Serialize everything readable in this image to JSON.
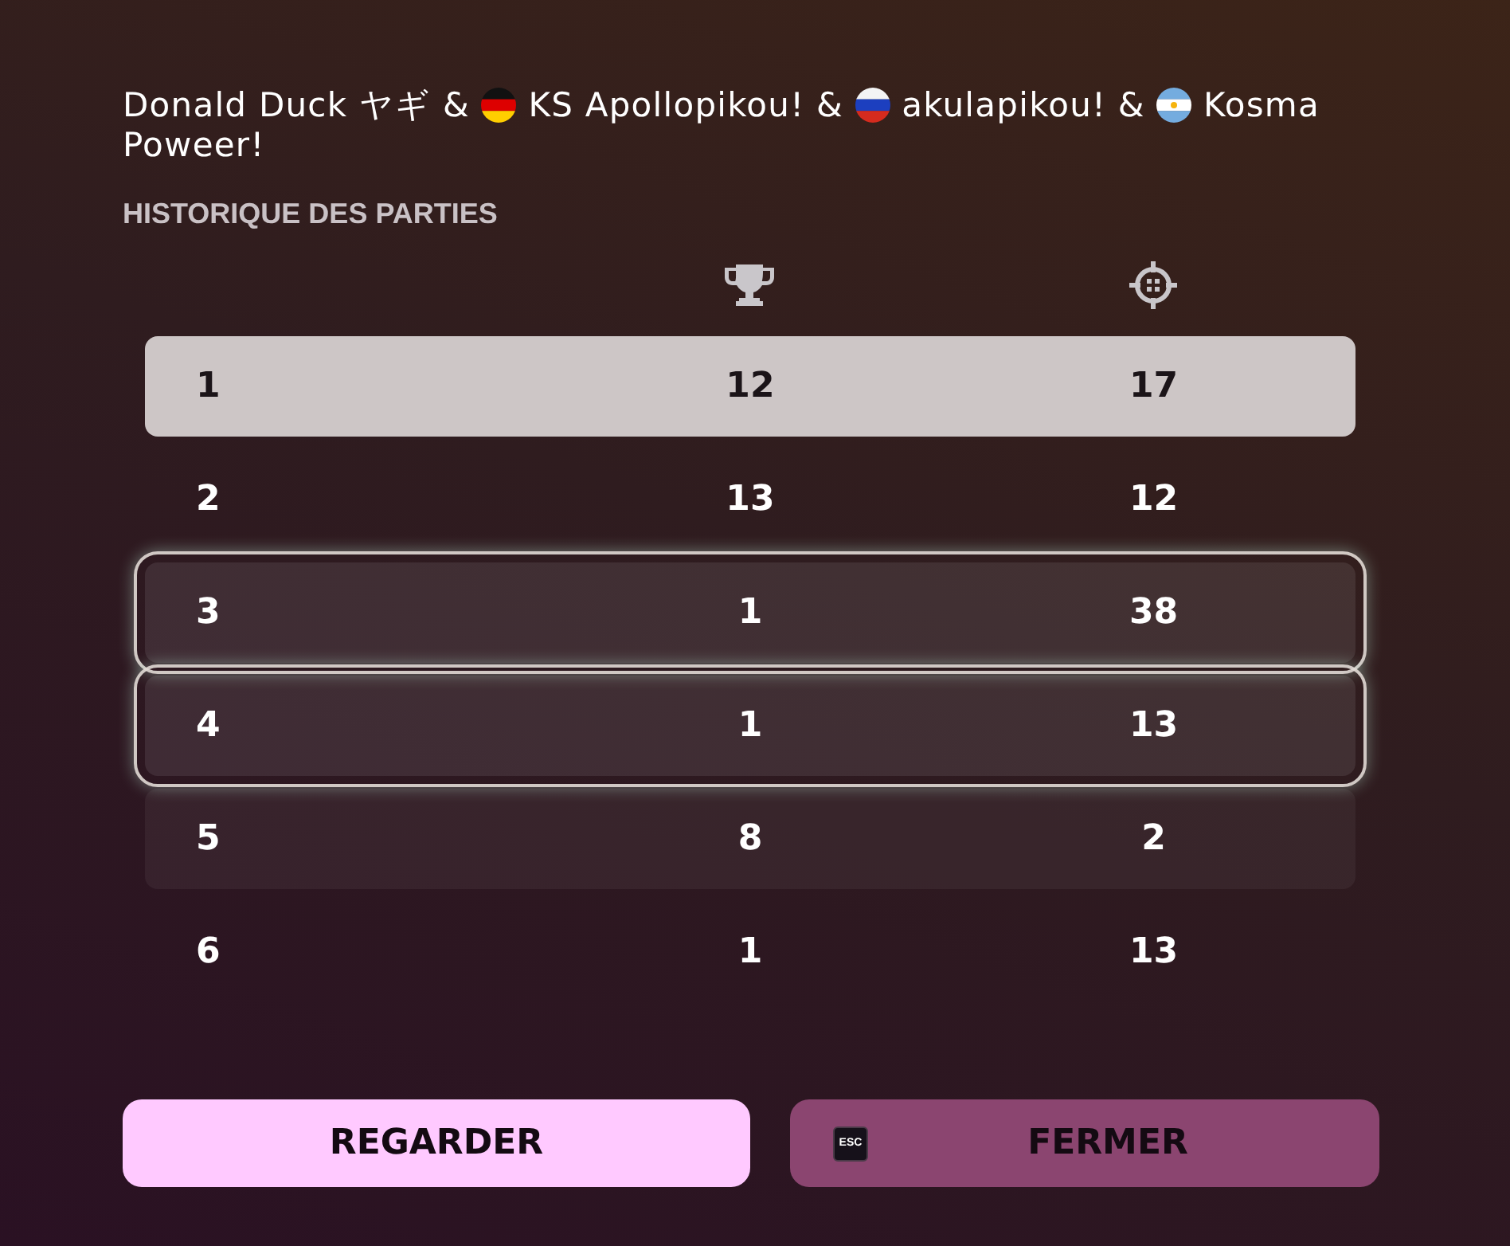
{
  "players": [
    {
      "kind": "plain",
      "name": "Donald Duck ヤギ"
    },
    {
      "joiner": "&",
      "kind": "germany",
      "name": "KS Apollopikou!"
    },
    {
      "joiner": "&",
      "kind": "russia",
      "name": "akulapikou!"
    },
    {
      "joiner": "&",
      "kind": "argentina",
      "name": "Kosma Poweer!"
    }
  ],
  "section_title": "HISTORIQUE DES PARTIES",
  "table": {
    "rows": [
      {
        "cells": [
          "1",
          "12",
          "17"
        ],
        "selected": true,
        "outlined": false,
        "shaded": false
      },
      {
        "cells": [
          "2",
          "13",
          "12"
        ],
        "selected": false,
        "outlined": false,
        "shaded": false
      },
      {
        "cells": [
          "3",
          "1",
          "38"
        ],
        "selected": false,
        "outlined": true,
        "shaded": true
      },
      {
        "cells": [
          "4",
          "1",
          "13"
        ],
        "selected": false,
        "outlined": true,
        "shaded": true
      },
      {
        "cells": [
          "5",
          "8",
          "2"
        ],
        "selected": false,
        "outlined": false,
        "shaded": true
      },
      {
        "cells": [
          "6",
          "1",
          "13"
        ],
        "selected": false,
        "outlined": false,
        "shaded": false
      }
    ]
  },
  "buttons": [
    {
      "label": "REGARDER",
      "kind": "primary"
    },
    {
      "label": "FERMER",
      "kind": "secondary",
      "key": "ESC"
    }
  ]
}
